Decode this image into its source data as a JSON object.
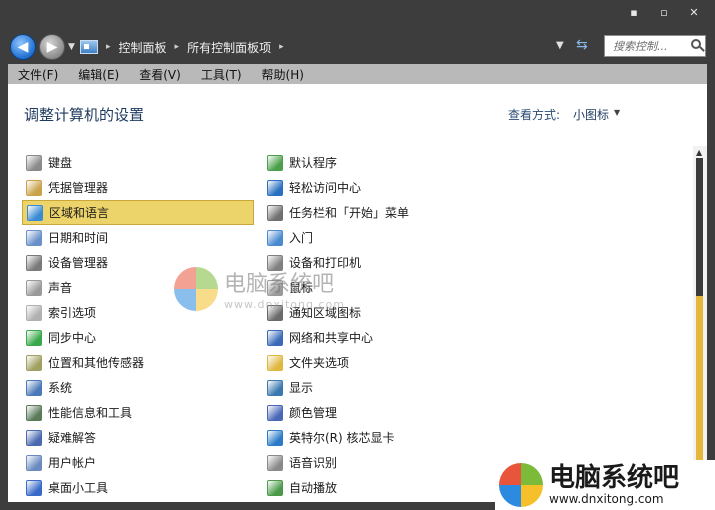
{
  "caption": {
    "minimize": "▪",
    "maximize": "▫",
    "close": "✕"
  },
  "address": {
    "crumbs": [
      "控制面板",
      "所有控制面板项"
    ],
    "search_placeholder": "搜索控制..."
  },
  "menu": [
    "文件(F)",
    "编辑(E)",
    "查看(V)",
    "工具(T)",
    "帮助(H)"
  ],
  "page": {
    "title": "调整计算机的设置",
    "view_label": "查看方式:",
    "view_value": "小图标"
  },
  "items_left": [
    {
      "label": "键盘",
      "icon": "keyboard-icon",
      "color": "#8a8a8a"
    },
    {
      "label": "凭据管理器",
      "icon": "credential-icon",
      "color": "#c9a24a"
    },
    {
      "label": "区域和语言",
      "icon": "globe-icon",
      "color": "#3a8ad4"
    },
    {
      "label": "日期和时间",
      "icon": "clock-icon",
      "color": "#6a90c8"
    },
    {
      "label": "设备管理器",
      "icon": "device-manager-icon",
      "color": "#7a7a7a"
    },
    {
      "label": "声音",
      "icon": "speaker-icon",
      "color": "#9a9a9a"
    },
    {
      "label": "索引选项",
      "icon": "index-icon",
      "color": "#b0b0b0"
    },
    {
      "label": "同步中心",
      "icon": "sync-icon",
      "color": "#3aa84a"
    },
    {
      "label": "位置和其他传感器",
      "icon": "sensor-icon",
      "color": "#a0a060"
    },
    {
      "label": "系统",
      "icon": "system-icon",
      "color": "#4a78b8"
    },
    {
      "label": "性能信息和工具",
      "icon": "performance-icon",
      "color": "#5a7a5a"
    },
    {
      "label": "疑难解答",
      "icon": "troubleshoot-icon",
      "color": "#4a6ab0"
    },
    {
      "label": "用户帐户",
      "icon": "user-icon",
      "color": "#6a8ac0"
    },
    {
      "label": "桌面小工具",
      "icon": "gadget-icon",
      "color": "#3a6ac8"
    }
  ],
  "items_right": [
    {
      "label": "默认程序",
      "icon": "default-programs-icon",
      "color": "#4aa04a"
    },
    {
      "label": "轻松访问中心",
      "icon": "accessibility-icon",
      "color": "#2a70c0"
    },
    {
      "label": "任务栏和「开始」菜单",
      "icon": "taskbar-icon",
      "color": "#707070"
    },
    {
      "label": "入门",
      "icon": "getting-started-icon",
      "color": "#4a8ad0"
    },
    {
      "label": "设备和打印机",
      "icon": "printer-icon",
      "color": "#808080"
    },
    {
      "label": "鼠标",
      "icon": "mouse-icon",
      "color": "#9a9a9a"
    },
    {
      "label": "通知区域图标",
      "icon": "notification-icon",
      "color": "#6a6a6a"
    },
    {
      "label": "网络和共享中心",
      "icon": "network-icon",
      "color": "#3a6ab8"
    },
    {
      "label": "文件夹选项",
      "icon": "folder-icon",
      "color": "#e0b840"
    },
    {
      "label": "显示",
      "icon": "display-icon",
      "color": "#3a78b0"
    },
    {
      "label": "颜色管理",
      "icon": "color-management-icon",
      "color": "#4a68b8"
    },
    {
      "label": "英特尔(R) 核芯显卡",
      "icon": "intel-graphics-icon",
      "color": "#2a7ac8"
    },
    {
      "label": "语音识别",
      "icon": "microphone-icon",
      "color": "#8a8a8a"
    },
    {
      "label": "自动播放",
      "icon": "autoplay-icon",
      "color": "#4a9a4a"
    }
  ],
  "selected_item": "区域和语言",
  "watermark": {
    "title": "电脑系统吧",
    "url": "www.dnxitong.com"
  }
}
